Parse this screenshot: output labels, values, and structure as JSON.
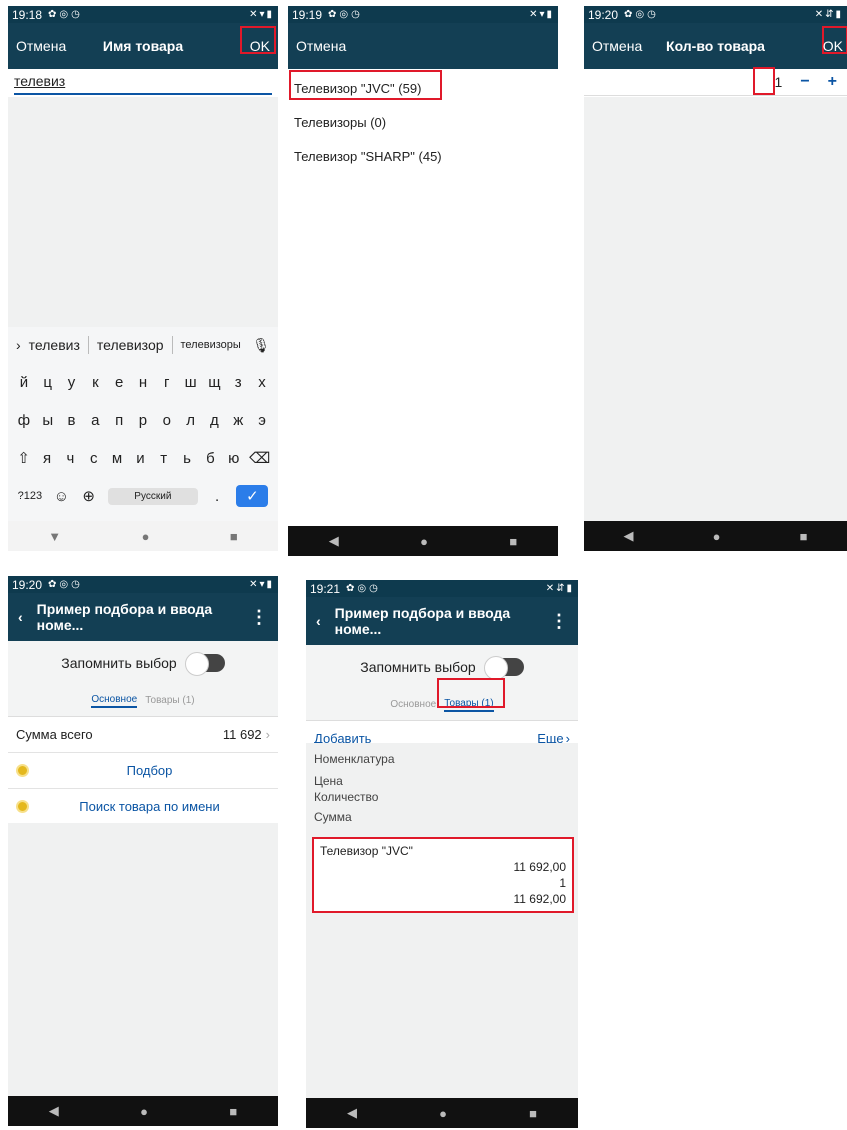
{
  "screen1": {
    "time": "19:18",
    "cancel": "Отмена",
    "title": "Имя товара",
    "ok": "OK",
    "input_value": "телевиз",
    "suggestions": [
      "телевиз",
      "телевизор",
      "телевизоры"
    ],
    "keys_row1": [
      "й",
      "ц",
      "у",
      "к",
      "е",
      "н",
      "г",
      "ш",
      "щ",
      "з",
      "х"
    ],
    "keys_row2": [
      "ф",
      "ы",
      "в",
      "а",
      "п",
      "р",
      "о",
      "л",
      "д",
      "ж",
      "э"
    ],
    "keys_row3": [
      "я",
      "ч",
      "с",
      "м",
      "и",
      "т",
      "ь",
      "б",
      "ю"
    ],
    "key_123": "?123",
    "space": "Русский",
    "dot": "."
  },
  "screen2": {
    "time": "19:19",
    "cancel": "Отмена",
    "items": [
      "Телевизор \"JVC\" (59)",
      "Телевизоры (0)",
      "Телевизор \"SHARP\" (45)"
    ]
  },
  "screen3": {
    "time": "19:20",
    "cancel": "Отмена",
    "title": "Кол-во товара",
    "ok": "OK",
    "qty": "1",
    "minus": "−",
    "plus": "+"
  },
  "screen4": {
    "time": "19:20",
    "title": "Пример подбора и ввода номе...",
    "remember": "Запомнить выбор",
    "tab_main": "Основное",
    "tab_goods": "Товары (1)",
    "sum_label": "Сумма всего",
    "sum_value": "11 692",
    "link1": "Подбор",
    "link2": "Поиск товара по имени"
  },
  "screen5": {
    "time": "19:21",
    "title": "Пример подбора и ввода номе...",
    "remember": "Запомнить выбор",
    "tab_main": "Основное",
    "tab_goods": "Товары (1)",
    "add": "Добавить",
    "more": "Еще",
    "col_nom": "Номенклатура",
    "col_price": "Цена",
    "col_qty": "Количество",
    "col_sum": "Сумма",
    "item_name": "Телевизор \"JVC\"",
    "item_price": "11 692,00",
    "item_qty": "1",
    "item_sum": "11 692,00"
  }
}
